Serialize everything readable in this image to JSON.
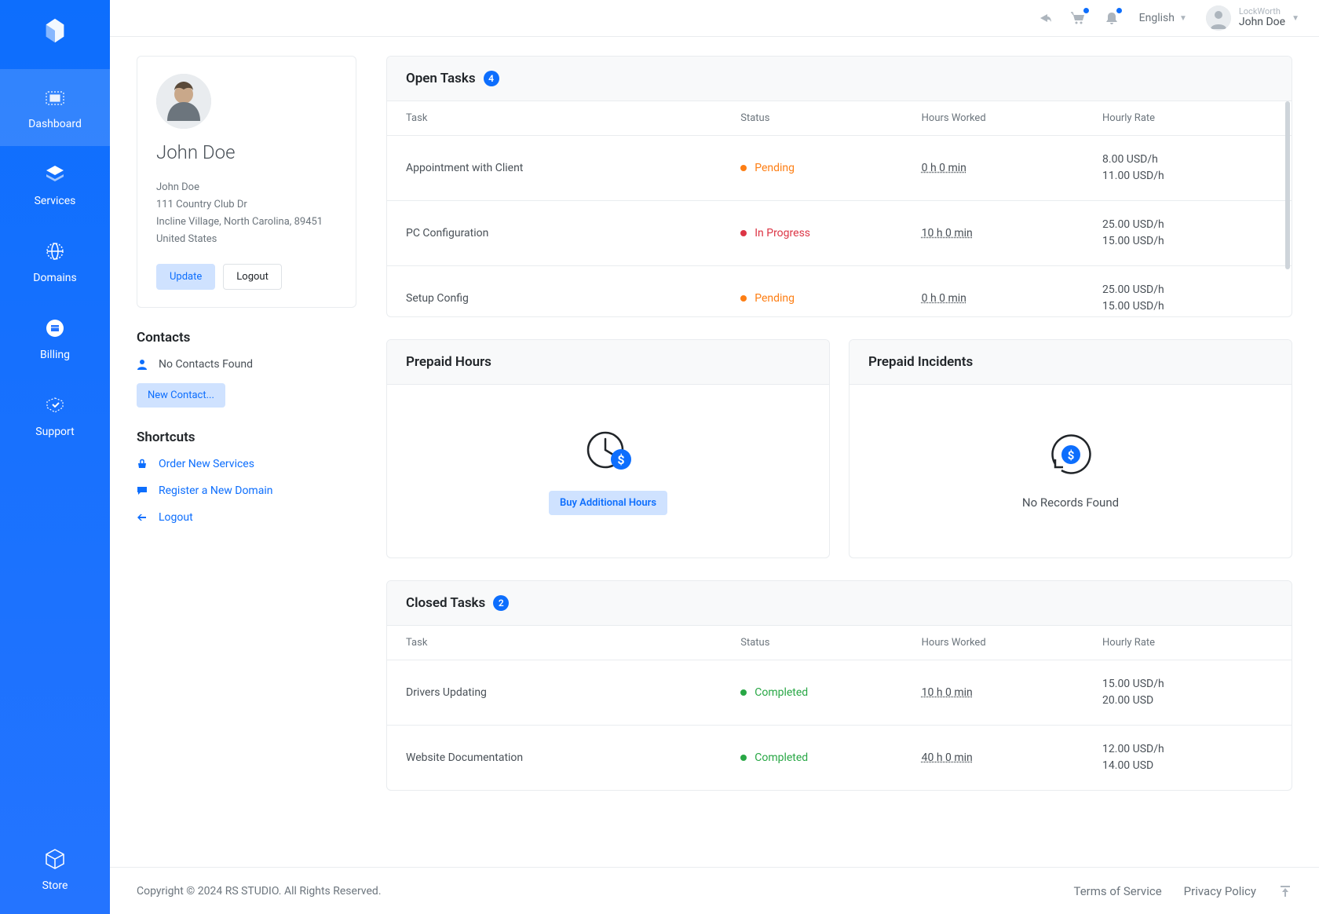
{
  "topbar": {
    "language": "English",
    "company": "LockWorth",
    "user_name": "John Doe"
  },
  "sidebar": {
    "items": [
      {
        "label": "Dashboard",
        "active": true
      },
      {
        "label": "Services"
      },
      {
        "label": "Domains"
      },
      {
        "label": "Billing"
      },
      {
        "label": "Support"
      }
    ],
    "store_label": "Store"
  },
  "profile": {
    "name": "John Doe",
    "address_lines": [
      "John Doe",
      "111 Country Club Dr",
      "Incline Village, North Carolina, 89451",
      "United States"
    ],
    "update_btn": "Update",
    "logout_btn": "Logout"
  },
  "contacts": {
    "title": "Contacts",
    "empty_text": "No Contacts Found",
    "new_btn": "New Contact..."
  },
  "shortcuts": {
    "title": "Shortcuts",
    "links": [
      {
        "label": "Order New Services"
      },
      {
        "label": "Register a New Domain"
      },
      {
        "label": "Logout"
      }
    ]
  },
  "open_tasks": {
    "title": "Open Tasks",
    "count": "4",
    "columns": [
      "Task",
      "Status",
      "Hours Worked",
      "Hourly Rate"
    ],
    "rows": [
      {
        "task": "Appointment with Client",
        "status": "Pending",
        "status_key": "pending",
        "hours": "0 h 0 min",
        "rate1": "8.00 USD/h",
        "rate2": "11.00 USD/h"
      },
      {
        "task": "PC Configuration",
        "status": "In Progress",
        "status_key": "inprogress",
        "hours": "10 h 0 min",
        "rate1": "25.00 USD/h",
        "rate2": "15.00 USD/h"
      },
      {
        "task": "Setup Config",
        "status": "Pending",
        "status_key": "pending",
        "hours": "0 h 0 min",
        "rate1": "25.00 USD/h",
        "rate2": "15.00 USD/h"
      }
    ]
  },
  "prepaid_hours": {
    "title": "Prepaid Hours",
    "buy_btn": "Buy Additional Hours"
  },
  "prepaid_incidents": {
    "title": "Prepaid Incidents",
    "empty": "No Records Found"
  },
  "closed_tasks": {
    "title": "Closed Tasks",
    "count": "2",
    "columns": [
      "Task",
      "Status",
      "Hours Worked",
      "Hourly Rate"
    ],
    "rows": [
      {
        "task": "Drivers Updating",
        "status": "Completed",
        "status_key": "completed",
        "hours": "10 h 0 min",
        "rate1": "15.00 USD/h",
        "rate2": "20.00 USD"
      },
      {
        "task": "Website Documentation",
        "status": "Completed",
        "status_key": "completed",
        "hours": "40 h 0 min",
        "rate1": "12.00 USD/h",
        "rate2": "14.00 USD"
      }
    ]
  },
  "footer": {
    "copyright": "Copyright © 2024 RS STUDIO. All Rights Reserved.",
    "tos": "Terms of Service",
    "privacy": "Privacy Policy"
  }
}
